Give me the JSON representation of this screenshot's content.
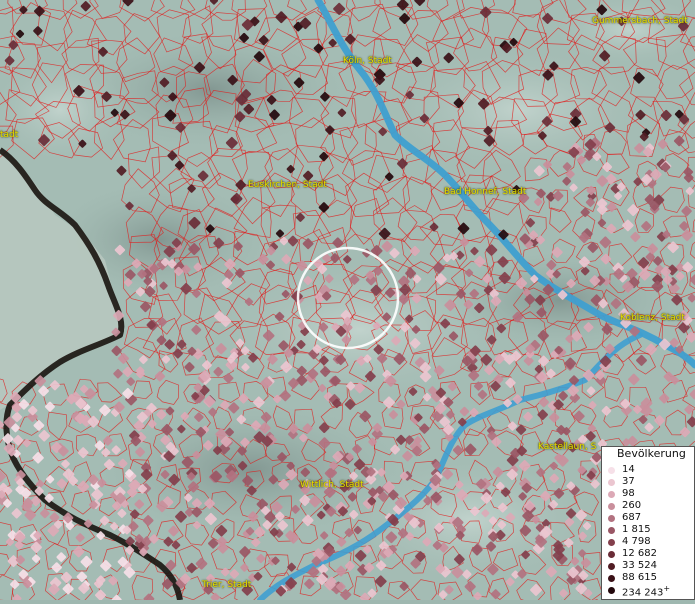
{
  "map": {
    "cities": [
      {
        "id": "gummersbach",
        "name": "Gummersbach, Stadt"
      },
      {
        "id": "koeln",
        "name": "Köln, Stadt"
      },
      {
        "id": "euskirchen",
        "name": "Euskirchen, Stadt"
      },
      {
        "id": "bad-honnef",
        "name": "Bad Honnef, Stadt"
      },
      {
        "id": "koblenz",
        "name": "Koblenz, Stadt"
      },
      {
        "id": "kastellaun",
        "name": "Kastellaun, S"
      },
      {
        "id": "wittlich",
        "name": "Wittlich, Stadt"
      },
      {
        "id": "trier",
        "name": "Trier, Stadt"
      },
      {
        "id": "edge",
        "name": "tadt"
      }
    ],
    "colors": {
      "river": "#3f9fd0",
      "boundary": "#e21a1a",
      "border": "#1a1410",
      "city_label": "#e8e000",
      "marker_ring": "#ffffff"
    }
  },
  "legend": {
    "title": "Bevölkerung",
    "items": [
      {
        "label": "14",
        "color": "#f6e0e8"
      },
      {
        "label": "37",
        "color": "#ebc6d0"
      },
      {
        "label": "98",
        "color": "#dca9b6"
      },
      {
        "label": "260",
        "color": "#c98f9c"
      },
      {
        "label": "687",
        "color": "#b27280"
      },
      {
        "label": "1 815",
        "color": "#9a5765"
      },
      {
        "label": "4 798",
        "color": "#833f4c"
      },
      {
        "label": "12 682",
        "color": "#6a2c37"
      },
      {
        "label": "33 524",
        "color": "#511c24"
      },
      {
        "label": "88 615",
        "color": "#3a1017"
      },
      {
        "label": "234 243",
        "color": "#23080c"
      }
    ],
    "plus_sign": "+"
  }
}
